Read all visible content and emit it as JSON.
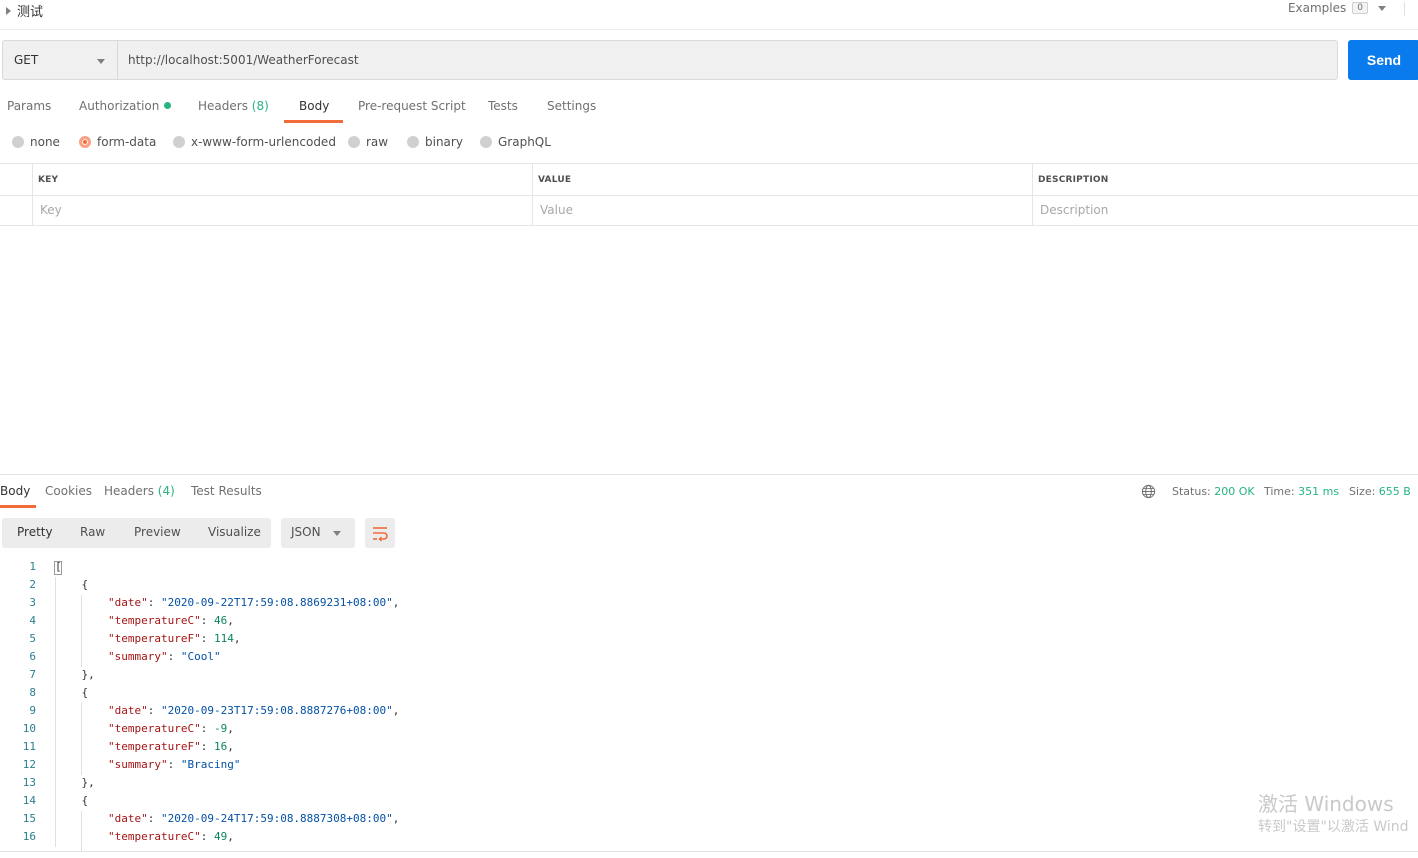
{
  "header": {
    "title": "测试",
    "examples_label": "Examples",
    "examples_count": "0"
  },
  "request": {
    "method": "GET",
    "url": "http://localhost:5001/WeatherForecast",
    "send_label": "Send"
  },
  "request_tabs": {
    "params": "Params",
    "authorization": "Authorization",
    "headers": "Headers",
    "headers_count": "(8)",
    "body": "Body",
    "prerequest": "Pre-request Script",
    "tests": "Tests",
    "settings": "Settings"
  },
  "body_types": {
    "none": "none",
    "form_data": "form-data",
    "urlencoded": "x-www-form-urlencoded",
    "raw": "raw",
    "binary": "binary",
    "graphql": "GraphQL",
    "selected": "form-data"
  },
  "kv_table": {
    "headers": [
      "KEY",
      "VALUE",
      "DESCRIPTION"
    ],
    "placeholders": [
      "Key",
      "Value",
      "Description"
    ]
  },
  "response_tabs": {
    "body": "Body",
    "cookies": "Cookies",
    "headers": "Headers",
    "headers_count": "(4)",
    "test_results": "Test Results"
  },
  "response_status": {
    "status_label": "Status:",
    "status_value": "200 OK",
    "time_label": "Time:",
    "time_value": "351 ms",
    "size_label": "Size:",
    "size_value": "655 B"
  },
  "format": {
    "pretty": "Pretty",
    "raw": "Raw",
    "preview": "Preview",
    "visualize": "Visualize",
    "language": "JSON"
  },
  "code_lines": [
    {
      "n": "1",
      "text": "["
    },
    {
      "n": "2",
      "text": "    {"
    },
    {
      "n": "3",
      "key": "\"date\"",
      "val": "\"2020-09-22T17:59:08.8869231+08:00\"",
      "type": "s",
      "tail": ","
    },
    {
      "n": "4",
      "key": "\"temperatureC\"",
      "val": "46",
      "type": "n",
      "tail": ","
    },
    {
      "n": "5",
      "key": "\"temperatureF\"",
      "val": "114",
      "type": "n",
      "tail": ","
    },
    {
      "n": "6",
      "key": "\"summary\"",
      "val": "\"Cool\"",
      "type": "s",
      "tail": ""
    },
    {
      "n": "7",
      "text": "    },"
    },
    {
      "n": "8",
      "text": "    {"
    },
    {
      "n": "9",
      "key": "\"date\"",
      "val": "\"2020-09-23T17:59:08.8887276+08:00\"",
      "type": "s",
      "tail": ","
    },
    {
      "n": "10",
      "key": "\"temperatureC\"",
      "val": "-9",
      "type": "n",
      "tail": ","
    },
    {
      "n": "11",
      "key": "\"temperatureF\"",
      "val": "16",
      "type": "n",
      "tail": ","
    },
    {
      "n": "12",
      "key": "\"summary\"",
      "val": "\"Bracing\"",
      "type": "s",
      "tail": ""
    },
    {
      "n": "13",
      "text": "    },"
    },
    {
      "n": "14",
      "text": "    {"
    },
    {
      "n": "15",
      "key": "\"date\"",
      "val": "\"2020-09-24T17:59:08.8887308+08:00\"",
      "type": "s",
      "tail": ","
    },
    {
      "n": "16",
      "key": "\"temperatureC\"",
      "val": "49",
      "type": "n",
      "tail": ","
    }
  ],
  "watermark": {
    "line1": "激活 Windows",
    "line2": "转到\"设置\"以激活 Wind"
  },
  "colors": {
    "accent": "#f26b3a",
    "send": "#097bed",
    "success": "#26b47f"
  }
}
